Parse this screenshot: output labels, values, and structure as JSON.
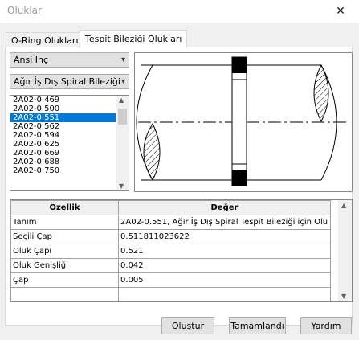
{
  "window": {
    "title": "Oluklar",
    "close_glyph": "✕"
  },
  "tabs": [
    {
      "label": "O-Ring Olukları",
      "active": false
    },
    {
      "label": "Tespit Bileziği Olukları",
      "active": true
    }
  ],
  "standard_select": {
    "value": "Ansi İnç"
  },
  "type_select": {
    "value": "Ağır İş Dış Spiral Bileziği"
  },
  "size_list": {
    "items": [
      "2A02-0.469",
      "2A02-0.500",
      "2A02-0.551",
      "2A02-0.562",
      "2A02-0.594",
      "2A02-0.625",
      "2A02-0.669",
      "2A02-0.688",
      "2A02-0.750"
    ],
    "selected": "2A02-0.551"
  },
  "properties": {
    "headers": [
      "Özellik",
      "Değer"
    ],
    "rows": [
      {
        "name": "Tanım",
        "value": "2A02-0.551, Ağır İş Dış Spiral Tespit Bileziği için Olu"
      },
      {
        "name": "Seçili Çap",
        "value": "0.511811023622"
      },
      {
        "name": "Oluk Çapı",
        "value": "0.521"
      },
      {
        "name": "Oluk Genişliği",
        "value": "0.042"
      },
      {
        "name": "Çap",
        "value": "0.005"
      }
    ]
  },
  "buttons": {
    "create": "Oluştur",
    "done": "Tamamlandı",
    "help": "Yardım"
  },
  "colors": {
    "selection": "#0078d7",
    "dialog_bg": "#f0f0f0"
  }
}
